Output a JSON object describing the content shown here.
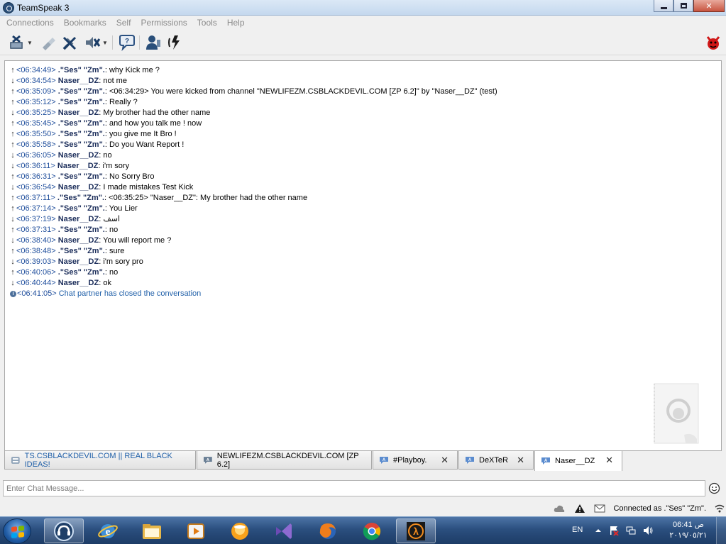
{
  "window": {
    "title": "TeamSpeak 3"
  },
  "menu": [
    "Connections",
    "Bookmarks",
    "Self",
    "Permissions",
    "Tools",
    "Help"
  ],
  "chat": {
    "lines": [
      {
        "dir": "out",
        "time": "<06:34:49>",
        "nick": ".\"Ses\" \"Zm\".",
        "msg": ": why Kick me ?"
      },
      {
        "dir": "in",
        "time": "<06:34:54>",
        "nick": "Naser__DZ",
        "msg": ": not me"
      },
      {
        "dir": "out",
        "time": "<06:35:09>",
        "nick": ".\"Ses\" \"Zm\".",
        "msg": ": <06:34:29> You were kicked from channel \"NEWLIFEZM.CSBLACKDEVIL.COM [ZP 6.2]\" by \"Naser__DZ\" (test)"
      },
      {
        "dir": "out",
        "time": "<06:35:12>",
        "nick": ".\"Ses\" \"Zm\".",
        "msg": ": Really ?"
      },
      {
        "dir": "in",
        "time": "<06:35:25>",
        "nick": "Naser__DZ",
        "msg": ": My brother had the other name"
      },
      {
        "dir": "out",
        "time": "<06:35:45>",
        "nick": ".\"Ses\" \"Zm\".",
        "msg": ": and how you talk me ! now"
      },
      {
        "dir": "out",
        "time": "<06:35:50>",
        "nick": ".\"Ses\" \"Zm\".",
        "msg": ": you give me It Bro !"
      },
      {
        "dir": "out",
        "time": "<06:35:58>",
        "nick": ".\"Ses\" \"Zm\".",
        "msg": ": Do you Want Report !"
      },
      {
        "dir": "in",
        "time": "<06:36:05>",
        "nick": "Naser__DZ",
        "msg": ": no"
      },
      {
        "dir": "in",
        "time": "<06:36:11>",
        "nick": "Naser__DZ",
        "msg": ": i'm sory"
      },
      {
        "dir": "out",
        "time": "<06:36:31>",
        "nick": ".\"Ses\" \"Zm\".",
        "msg": ": No Sorry Bro"
      },
      {
        "dir": "in",
        "time": "<06:36:54>",
        "nick": "Naser__DZ",
        "msg": ": I made mistakes Test Kick"
      },
      {
        "dir": "out",
        "time": "<06:37:11>",
        "nick": ".\"Ses\" \"Zm\".",
        "msg": ": <06:35:25> \"Naser__DZ\": My brother had the other name"
      },
      {
        "dir": "out",
        "time": "<06:37:14>",
        "nick": ".\"Ses\" \"Zm\".",
        "msg": ": You Lier"
      },
      {
        "dir": "in",
        "time": "<06:37:19>",
        "nick": "Naser__DZ",
        "msg": ": اسف"
      },
      {
        "dir": "out",
        "time": "<06:37:31>",
        "nick": ".\"Ses\" \"Zm\".",
        "msg": ": no"
      },
      {
        "dir": "in",
        "time": "<06:38:40>",
        "nick": "Naser__DZ",
        "msg": ": You will report me ?"
      },
      {
        "dir": "out",
        "time": "<06:38:48>",
        "nick": ".\"Ses\" \"Zm\".",
        "msg": ": sure"
      },
      {
        "dir": "in",
        "time": "<06:39:03>",
        "nick": "Naser__DZ",
        "msg": ": i'm sory pro"
      },
      {
        "dir": "out",
        "time": "<06:40:06>",
        "nick": ".\"Ses\" \"Zm\".",
        "msg": ": no"
      },
      {
        "dir": "in",
        "time": "<06:40:44>",
        "nick": "Naser__DZ",
        "msg": ": ok"
      }
    ],
    "info_line": {
      "time": "<06:41:05>",
      "msg": "Chat partner has closed the conversation"
    }
  },
  "tabs": [
    {
      "label": "TS.CSBLACKDEVIL.COM || REAL BLACK IDEAS!",
      "type": "server",
      "closable": false
    },
    {
      "label": "NEWLIFEZM.CSBLACKDEVIL.COM [ZP 6.2]",
      "type": "channel",
      "closable": false
    },
    {
      "label": "#Playboy.",
      "type": "private",
      "closable": true
    },
    {
      "label": "DeXTeR",
      "type": "private",
      "closable": true
    },
    {
      "label": "Naser__DZ",
      "type": "private",
      "closable": true,
      "active": true
    }
  ],
  "input": {
    "placeholder": "Enter Chat Message..."
  },
  "status": {
    "text": "Connected as .\"Ses\" \"Zm\"."
  },
  "taskbar": {
    "lang": "EN",
    "time": "06:41 ص",
    "date": "٢٠١٩/٠٥/٢١"
  },
  "colors": {
    "timestamp": "#1f4e9c",
    "nick": "#1b2d5a",
    "info": "#1f5fa8",
    "taskbar": "#2b4f7f",
    "close_button": "#c8543f"
  }
}
